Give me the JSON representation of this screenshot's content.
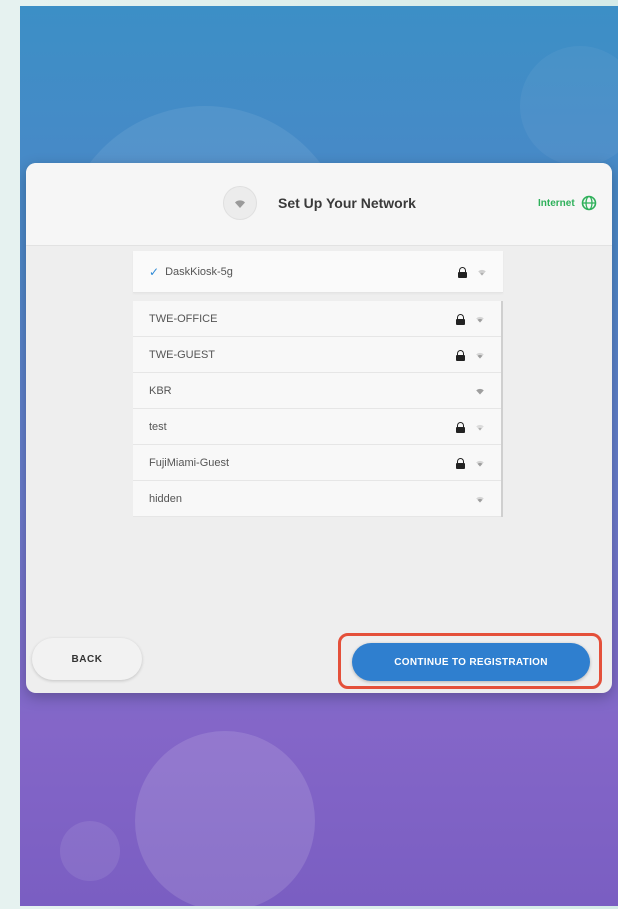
{
  "header": {
    "title": "Set Up Your Network",
    "internet_label": "Internet"
  },
  "networks": {
    "selected": {
      "name": "DaskKiosk-5g",
      "locked": true
    },
    "items": [
      {
        "name": "TWE-OFFICE",
        "locked": true
      },
      {
        "name": "TWE-GUEST",
        "locked": true
      },
      {
        "name": "KBR",
        "locked": false
      },
      {
        "name": "test",
        "locked": true
      },
      {
        "name": "FujiMiami-Guest",
        "locked": true
      },
      {
        "name": "hidden",
        "locked": false
      }
    ]
  },
  "footer": {
    "back_label": "BACK",
    "continue_label": "CONTINUE TO REGISTRATION"
  },
  "colors": {
    "accent": "#2f7fcf",
    "internet_green": "#2eb05a",
    "highlight": "#e4503a"
  }
}
